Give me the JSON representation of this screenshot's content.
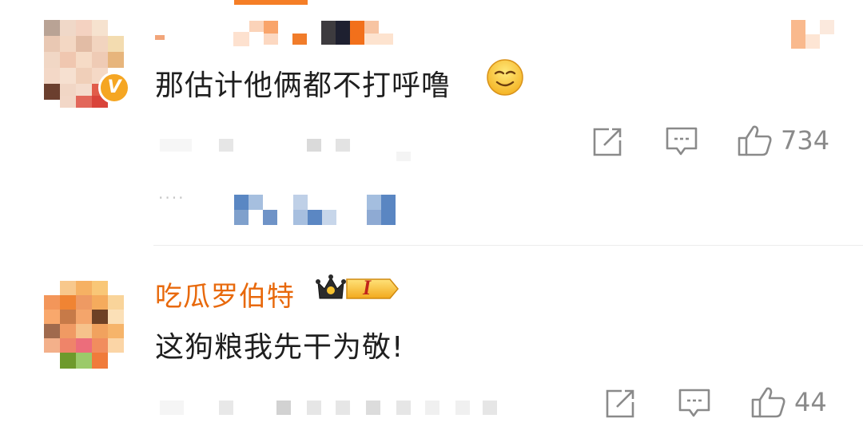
{
  "comments": [
    {
      "text": "那估计他俩都不打呼噜",
      "emoji": "smirk-face-emoji",
      "actions": {
        "share_icon": "share-icon",
        "reply_icon": "comment-icon",
        "like_icon": "thumbs-up-icon",
        "like_count": "734"
      },
      "replies_more": "····"
    },
    {
      "username": "吃瓜罗伯特",
      "badge_text": "I",
      "text": "这狗粮我先干为敬!",
      "actions": {
        "share_icon": "share-icon",
        "reply_icon": "comment-icon",
        "like_icon": "thumbs-up-icon",
        "like_count": "44"
      }
    }
  ],
  "colors": {
    "username": "#e8690c",
    "text": "#1f1f1f",
    "icon": "#8a8a8a",
    "verified": "#f5a623"
  }
}
